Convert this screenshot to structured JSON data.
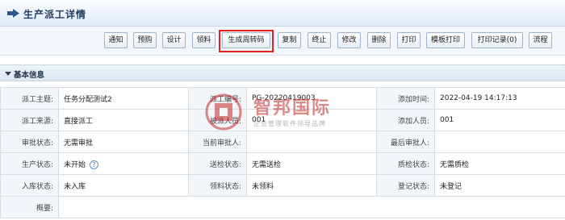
{
  "title": "生产派工详情",
  "toolbar": {
    "buttons": [
      "通知",
      "预购",
      "设计",
      "领料",
      "生成周转码",
      "复制",
      "终止",
      "修改",
      "删除",
      "打印",
      "模板打印",
      "打印记录(0)",
      "流程"
    ]
  },
  "section": {
    "label": "基本信息"
  },
  "info": {
    "rows": [
      [
        {
          "k": "派工主题:",
          "v": "任务分配测试2"
        },
        {
          "k": "派工编号:",
          "v": "PG-20220419003"
        },
        {
          "k": "添加时间:",
          "v": "2022-04-19 14:17:13"
        }
      ],
      [
        {
          "k": "派工来源:",
          "v": "直接派工"
        },
        {
          "k": "被派人员:",
          "v": "001"
        },
        {
          "k": "添加人员:",
          "v": "001"
        }
      ],
      [
        {
          "k": "审批状态:",
          "v": "无需审批"
        },
        {
          "k": "当前审批人:",
          "v": ""
        },
        {
          "k": "最后审批人:",
          "v": ""
        }
      ],
      [
        {
          "k": "生产状态:",
          "v": "未开始"
        },
        {
          "k": "送检状态:",
          "v": "无需送检"
        },
        {
          "k": "质检状态:",
          "v": "无需质检"
        }
      ],
      [
        {
          "k": "入库状态:",
          "v": "未入库"
        },
        {
          "k": "领料状态:",
          "v": "未领料"
        },
        {
          "k": "登记状态:",
          "v": "未登记"
        }
      ],
      [
        {
          "k": "概要:",
          "v": ""
        }
      ]
    ]
  },
  "watermark": {
    "main": "智邦国际",
    "sub": "企业管理软件领导品牌"
  },
  "colors": {
    "highlight": "#e32020",
    "header_text": "#1f3d63",
    "watermark": "#c62828"
  }
}
